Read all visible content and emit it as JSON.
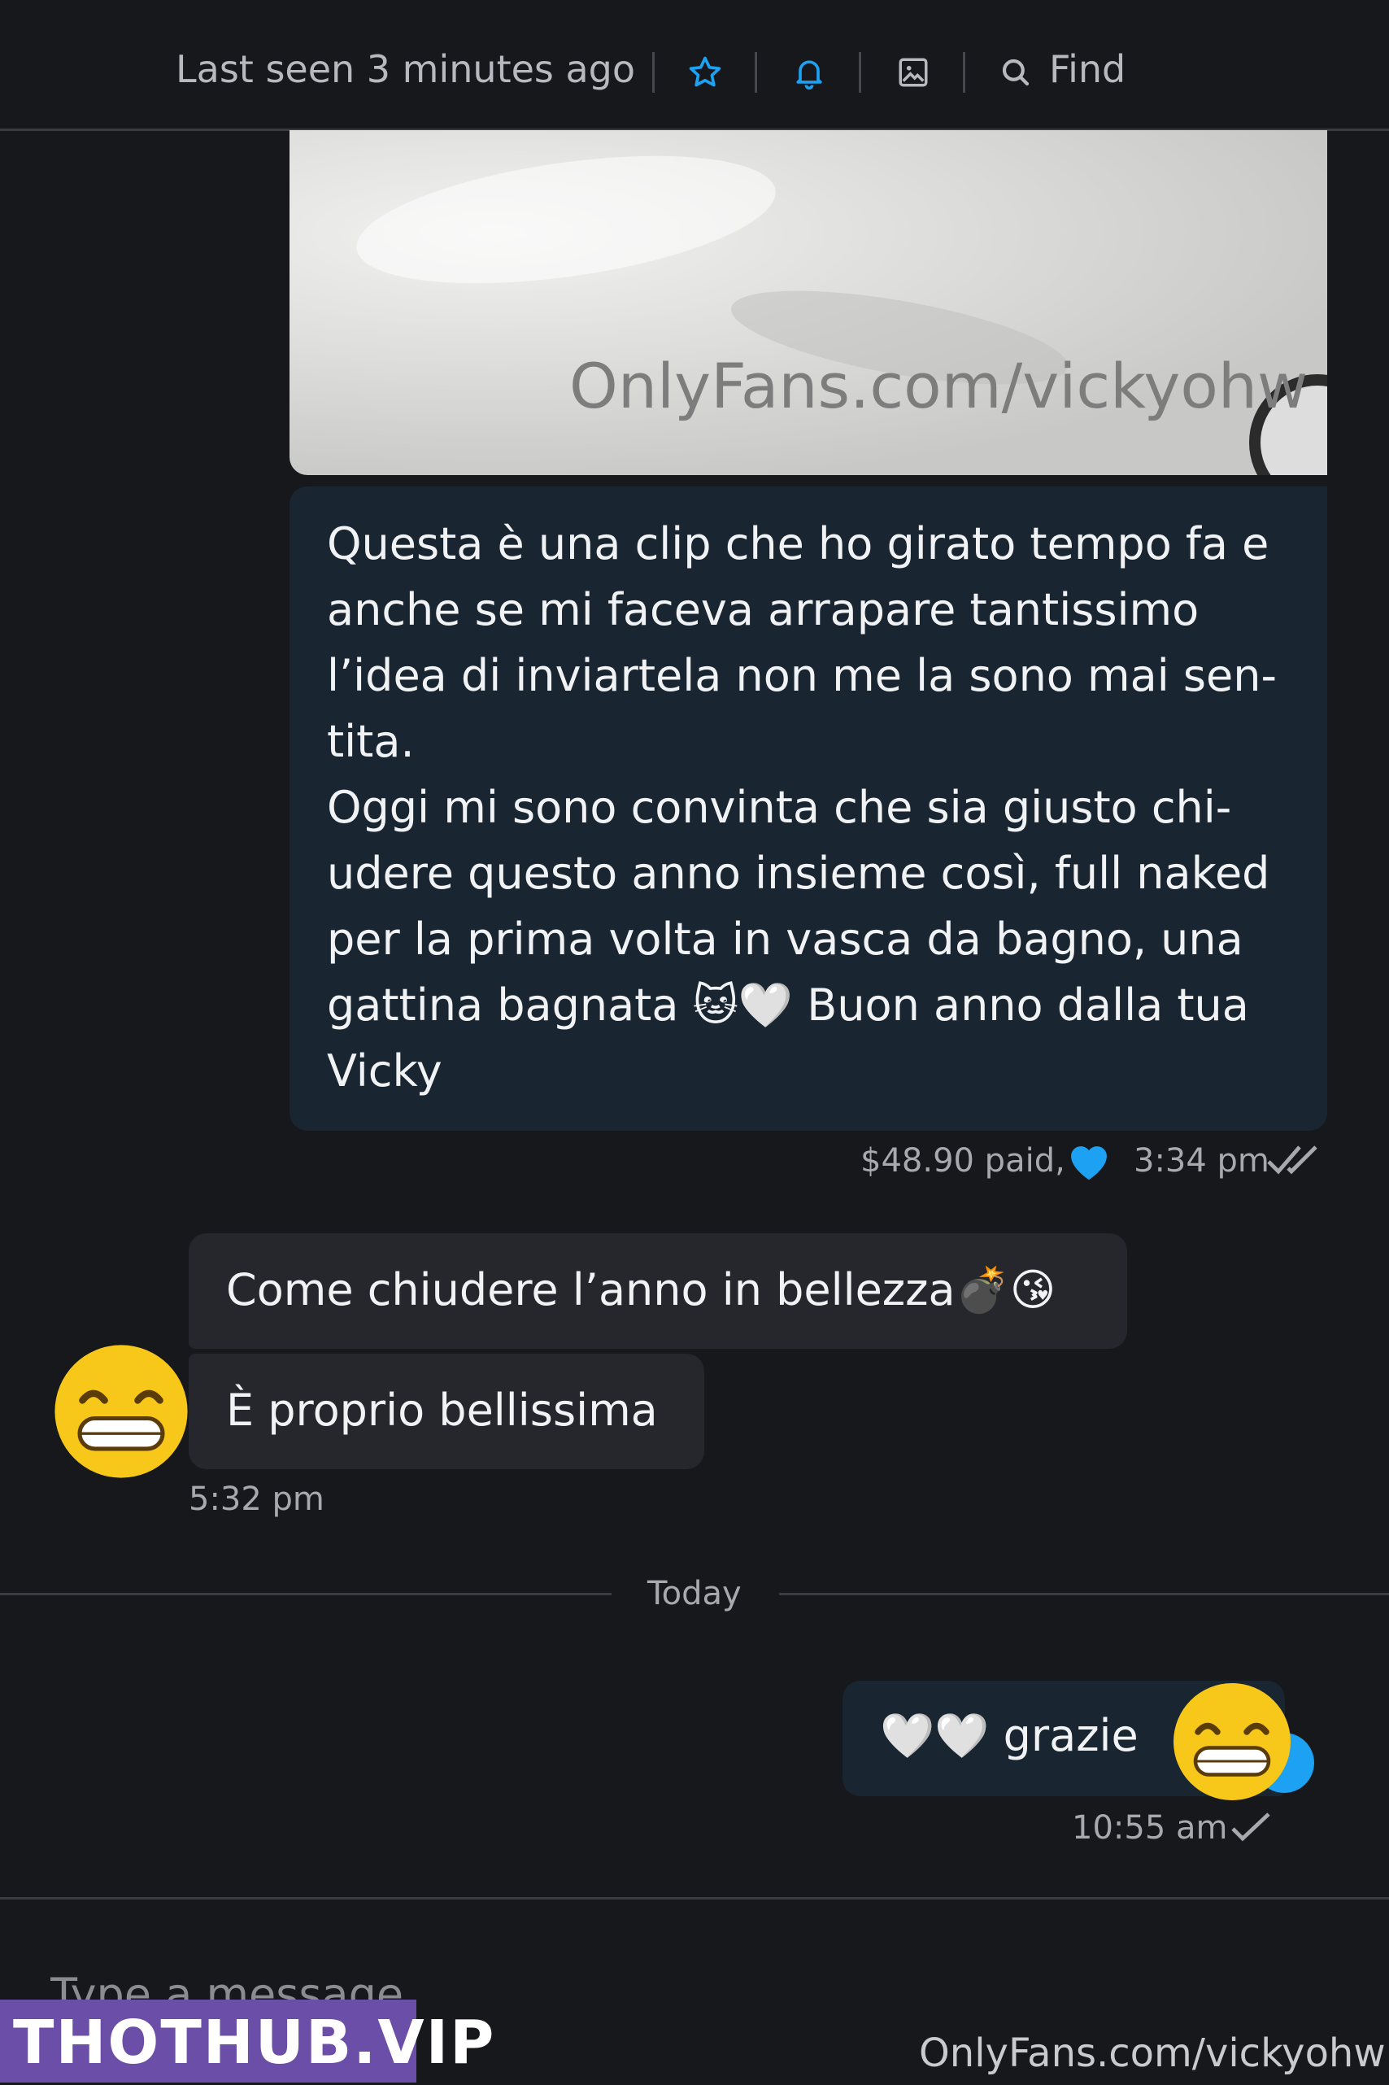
{
  "header": {
    "status": "Last seen 3 minutes ago",
    "find_label": "Find",
    "icons": [
      "star-icon",
      "bell-icon",
      "image-icon",
      "search-icon"
    ],
    "accent_color": "#1da1f2"
  },
  "media": {
    "watermark": "OnlyFans.com/vickyohw"
  },
  "messages": [
    {
      "direction": "out",
      "text_lines": [
        "Questa è una clip che ho girato tempo fa e",
        "anche se mi faceva arrapare tantissimo",
        "l’idea di inviartela non me la sono mai sen-",
        "tita.",
        "Oggi mi sono convinta che sia giusto chi-",
        "udere questo anno insieme così, full naked",
        "per la prima volta in vasca da bagno, una",
        "gattina bagnata 🐱🤍 Buon anno dalla tua",
        "Vicky"
      ],
      "price": "$48.90 paid,",
      "time": "3:34 pm"
    },
    {
      "direction": "in",
      "text": "Come chiudere l’anno in bellezza💣😘"
    },
    {
      "direction": "in",
      "text": "È proprio bellissima",
      "time": "5:32 pm"
    },
    {
      "direction": "out",
      "text": "🤍🤍 grazie",
      "time": "10:55 am"
    }
  ],
  "day_divider": "Today",
  "composer": {
    "placeholder": "Type a message"
  },
  "overlay": {
    "site_badge": "THOTHUB.VIP",
    "watermark": "OnlyFans.com/vickyohw"
  },
  "colors": {
    "background": "#17181c",
    "out_bubble": "#192632",
    "in_bubble": "#25272c",
    "heart": "#1da1f2"
  }
}
